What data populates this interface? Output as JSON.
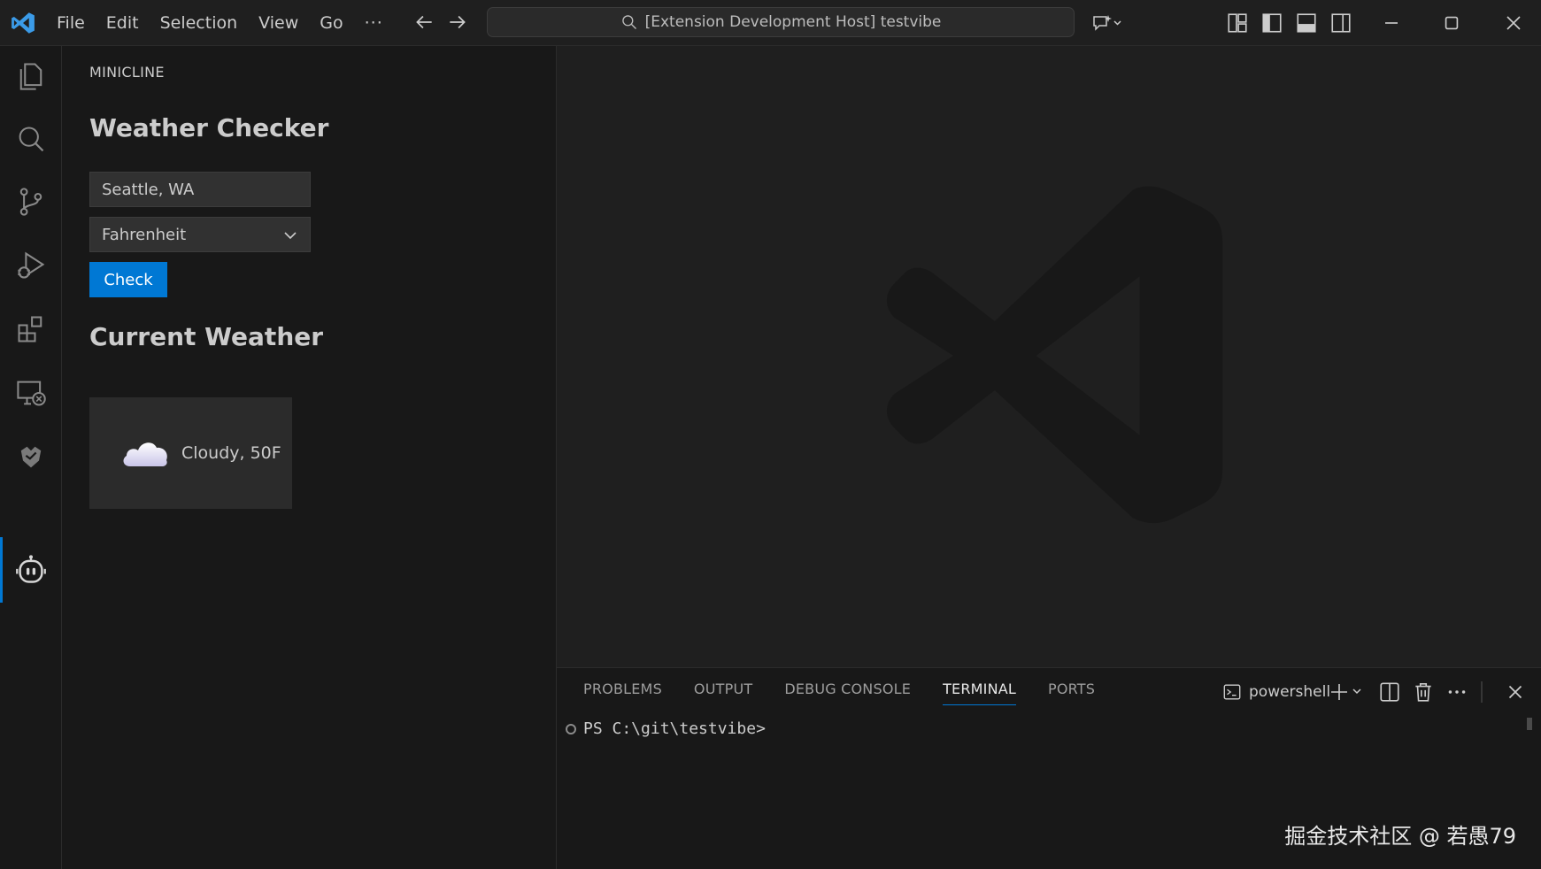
{
  "titlebar": {
    "menus": [
      "File",
      "Edit",
      "Selection",
      "View",
      "Go"
    ],
    "more": "···",
    "command_center": "[Extension Development Host] testvibe"
  },
  "sidebar": {
    "title": "MINICLINE",
    "heading": "Weather Checker",
    "city_value": "Seattle, WA",
    "unit_value": "Fahrenheit",
    "check_label": "Check",
    "current_heading": "Current Weather",
    "weather_text": "Cloudy, 50F"
  },
  "panel": {
    "tabs": [
      "PROBLEMS",
      "OUTPUT",
      "DEBUG CONSOLE",
      "TERMINAL",
      "PORTS"
    ],
    "active_tab": "TERMINAL",
    "shell": "powershell",
    "prompt": "PS C:\\git\\testvibe>"
  },
  "watermark": "掘金技术社区 @ 若愚79",
  "colors": {
    "accent": "#0078d4",
    "background": "#1f1f1f",
    "sidebar": "#181818"
  },
  "icons": {
    "activity": [
      "explorer-icon",
      "search-icon",
      "source-control-icon",
      "run-debug-icon",
      "extensions-icon",
      "remote-explorer-icon",
      "testing-icon",
      "robot-icon"
    ]
  }
}
